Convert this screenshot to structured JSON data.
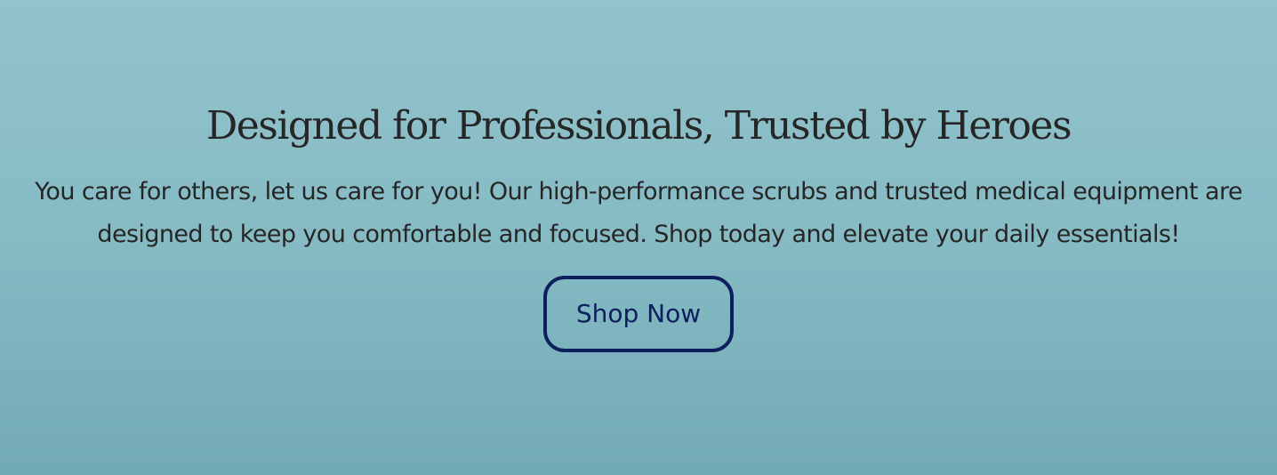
{
  "hero": {
    "title": "Designed for Professionals, Trusted by Heroes",
    "text": "You care for others, let us care for you! Our high-performance scrubs and trusted medical equipment are designed to keep you comfortable and focused. Shop today and elevate your daily essentials!",
    "button_label": "Shop Now"
  },
  "colors": {
    "background": "#86bbc4",
    "text": "#262626",
    "button_accent": "#0d1f5c"
  }
}
